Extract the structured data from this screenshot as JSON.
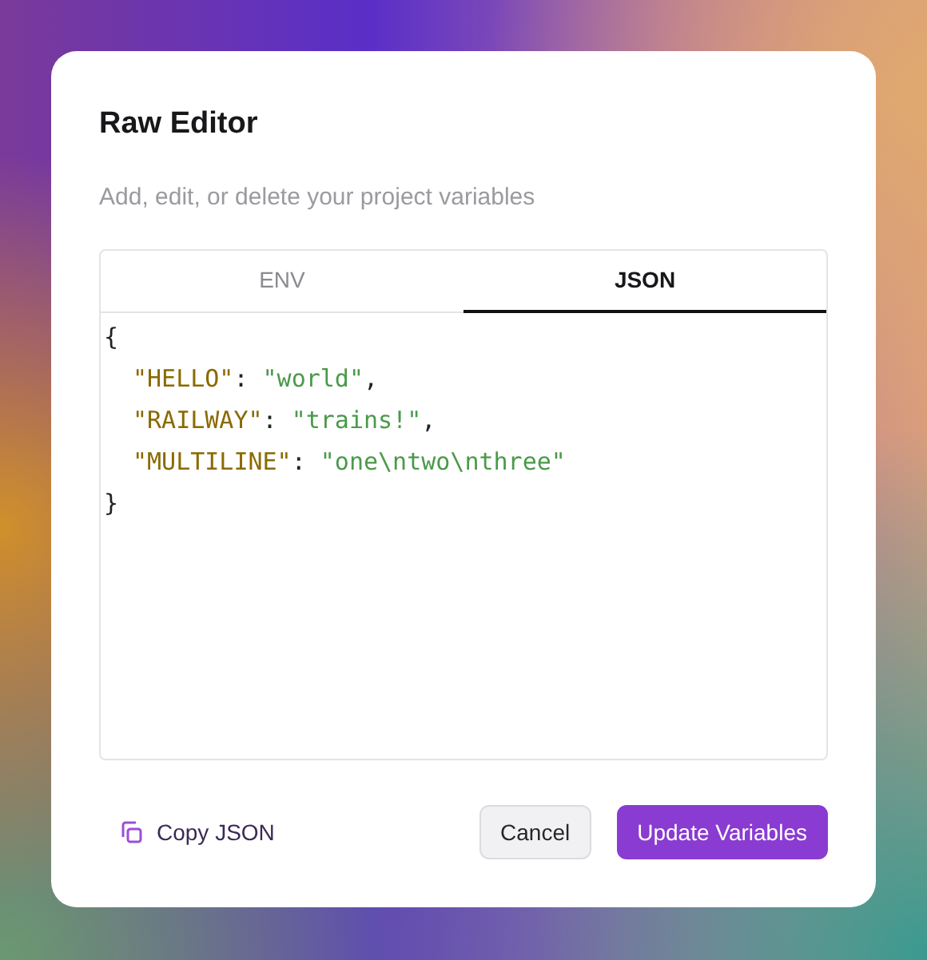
{
  "dialog": {
    "title": "Raw Editor",
    "subtitle": "Add, edit, or delete your project variables"
  },
  "tabs": [
    {
      "label": "ENV",
      "selected": false
    },
    {
      "label": "JSON",
      "selected": true
    }
  ],
  "editor": {
    "open": "{",
    "entries": [
      [
        {
          "kind": "key",
          "text": "\"HELLO\""
        },
        {
          "kind": "punct",
          "text": ": "
        },
        {
          "kind": "string",
          "text": "\"world\""
        },
        {
          "kind": "punct",
          "text": ","
        }
      ],
      [
        {
          "kind": "key",
          "text": "\"RAILWAY\""
        },
        {
          "kind": "punct",
          "text": ": "
        },
        {
          "kind": "string",
          "text": "\"trains!\""
        },
        {
          "kind": "punct",
          "text": ","
        }
      ],
      [
        {
          "kind": "key",
          "text": "\"MULTILINE\""
        },
        {
          "kind": "punct",
          "text": ": "
        },
        {
          "kind": "string",
          "text": "\"one\\ntwo\\nthree\""
        }
      ]
    ],
    "close": "}"
  },
  "footer": {
    "copy_label": "Copy JSON",
    "cancel": "Cancel",
    "submit": "Update Variables"
  }
}
